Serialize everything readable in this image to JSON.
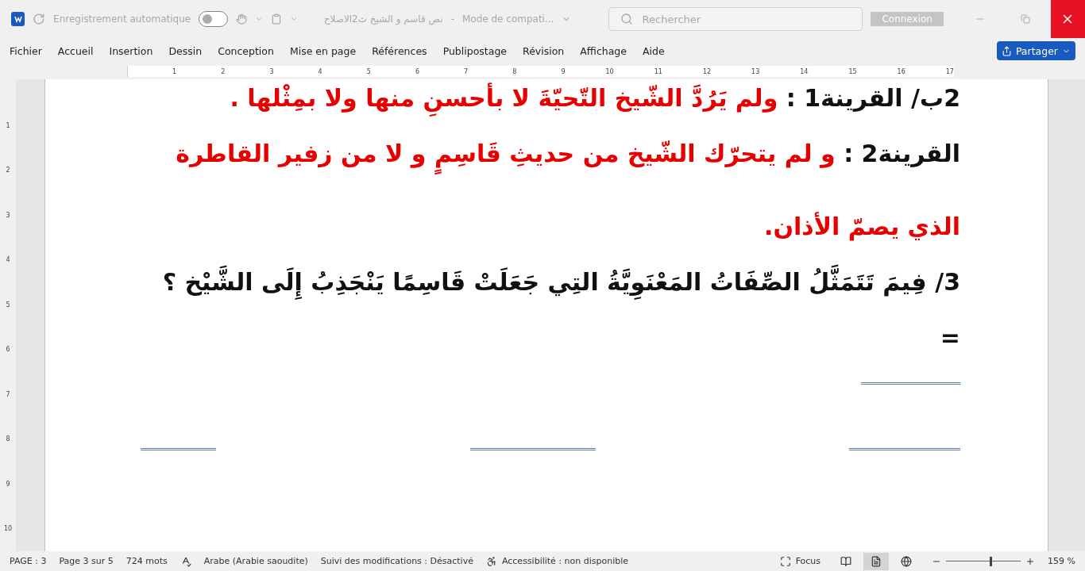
{
  "titlebar": {
    "autosave_label": "Enregistrement automatique",
    "autosave_on": false,
    "doc_title": "نص قاسم و الشيخ ث2الاصلاح",
    "separator": "-",
    "mode": "Mode de compati...",
    "search_placeholder": "Rechercher",
    "signin": "Connexion"
  },
  "menu": {
    "tabs": [
      "Fichier",
      "Accueil",
      "Insertion",
      "Dessin",
      "Conception",
      "Mise en page",
      "Références",
      "Publipostage",
      "Révision",
      "Affichage",
      "Aide"
    ],
    "share": "Partager"
  },
  "ruler": {
    "numbers": [
      "1",
      "2",
      "3",
      "4",
      "5",
      "6",
      "7",
      "8",
      "9",
      "10",
      "11",
      "12",
      "13",
      "14",
      "15",
      "16",
      "17"
    ]
  },
  "vertical_ruler": {
    "numbers": [
      "1",
      "2",
      "3",
      "4",
      "5",
      "6",
      "7",
      "8",
      "9",
      "10"
    ]
  },
  "document": {
    "paragraphs": [
      {
        "segments": [
          {
            "kind": "label",
            "text": "2ب/ القرينة1 :"
          },
          {
            "kind": "answer",
            "text": "ولم يَرُدَّ الشّيخ التّحيّةَ لا بأحسنِ منها ولا بمِثْلها ."
          }
        ]
      },
      {
        "segments": [
          {
            "kind": "label",
            "text": "القرينة2 :"
          },
          {
            "kind": "answer",
            "text": "و لم يتحرّك الشّيخ من حديثِ قَاسِمٍ و لا من زفير القاطرة الذي يصمّ الأذان."
          }
        ]
      },
      {
        "segments": [
          {
            "kind": "label",
            "text": "3/ فِيمَ تَتَمَثَّلُ الصِّفَاتُ المَعْنَوِيَّةُ التِي جَعَلَتْ قَاسِمًا يَنْجَذِبُ إِلَى الشَّيْخ ؟"
          }
        ]
      },
      {
        "segments": [
          {
            "kind": "label",
            "text": "="
          }
        ]
      }
    ]
  },
  "status": {
    "page": "PAGE : 3",
    "pages": "Page 3 sur 5",
    "words": "724 mots",
    "language": "Arabe (Arabie saoudite)",
    "tracking": "Suivi des modifications : Désactivé",
    "accessibility": "Accessibilité : non disponible",
    "focus": "Focus",
    "views": [
      {
        "kind": "read",
        "selected": false
      },
      {
        "kind": "print",
        "selected": true
      },
      {
        "kind": "web",
        "selected": false
      }
    ],
    "zoom": {
      "level": 0.6,
      "reading": "159 %"
    }
  }
}
